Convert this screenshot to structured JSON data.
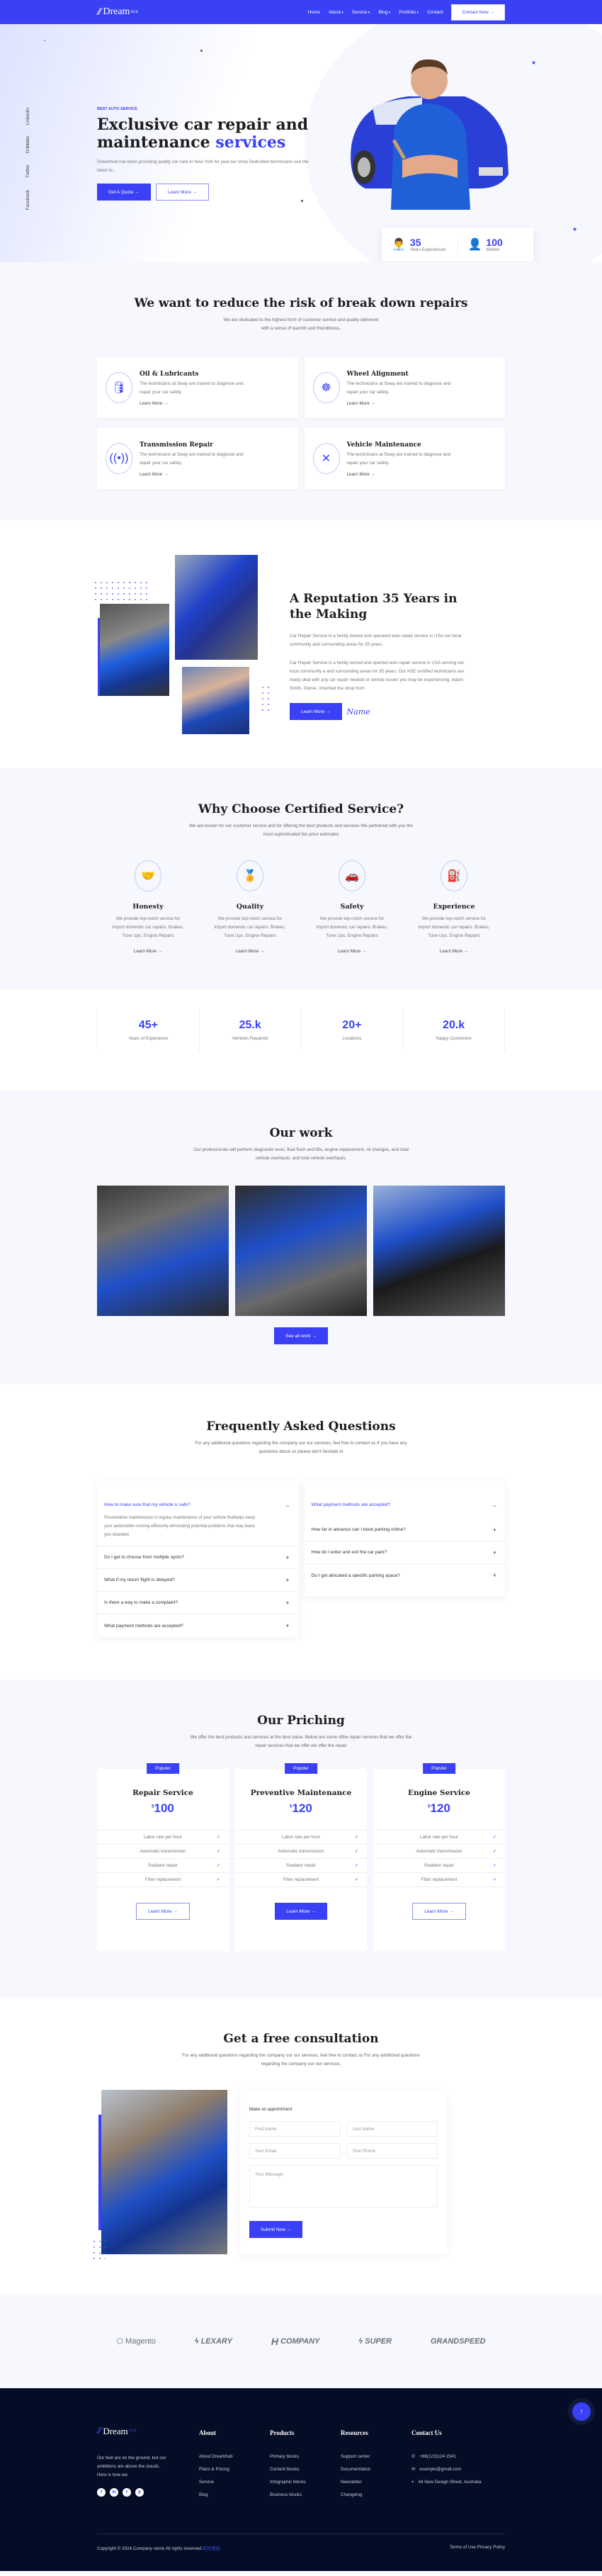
{
  "header": {
    "logo_text": "Dream",
    "logo_sup": "HUB",
    "nav": [
      {
        "label": "Home",
        "dropdown": false
      },
      {
        "label": "About",
        "dropdown": true
      },
      {
        "label": "Service",
        "dropdown": true
      },
      {
        "label": "Blog",
        "dropdown": true
      },
      {
        "label": "Protfolio",
        "dropdown": true
      },
      {
        "label": "Contact",
        "dropdown": false
      }
    ],
    "cta_label": "Contact Now →"
  },
  "hero": {
    "socials": [
      "Linkedin",
      "Dribbble",
      "Twitter",
      "Facebook"
    ],
    "eyebrow": "BEST AUTO SERVICE",
    "title_line1": "Exclusive car repair and",
    "title_line2": "maintenance ",
    "title_accent": "services",
    "description": "Dreamhub has been providing quality car care in New York for year.our shop Dedicated technicians use the latest te...",
    "btn_quote": "Get A Quote  →",
    "btn_learn": "Learn More  →",
    "stat1_num": "35",
    "stat1_label": "Years Experienced",
    "stat2_num": "100",
    "stat2_label": "Worker"
  },
  "services": {
    "title": "We want to reduce the risk of break down repairs",
    "subtitle": "We are dedicated to the highest form of customer service and quality delivered with a sense of warmth and friendliness.",
    "items": [
      {
        "title": "Oil & Lubricants",
        "text": "The technicians at Sway are trained to diagnose and repair your car safely.",
        "link": "Learn More  →",
        "icon": "oil-can-icon"
      },
      {
        "title": "Wheel Alignment",
        "text": "The technicians at Sway are trained to diagnose and repair your car safely.",
        "link": "Learn More  →",
        "icon": "wheel-icon"
      },
      {
        "title": "Transmission Repair",
        "text": "The technicians at Sway are trained to diagnose and repair your car safely.",
        "link": "Learn More  →",
        "icon": "signal-tower-icon"
      },
      {
        "title": "Vehicle Maintenance",
        "text": "The technicians at Sway are trained to diagnose and repair your car safely.",
        "link": "Learn More  →",
        "icon": "wrench-screwdriver-icon"
      }
    ]
  },
  "reputation": {
    "title": "A Reputation 35 Years in the Making",
    "para1": "Car Repair Service is a family owned and operated auto repair service in USA our local community and surrounding areas for 35 years.",
    "para2": "Car Repair Service is a family owned and operted auto repair service in USA serving our local community a and surrounding areas for 35 years. Our ASE certified technicians are ready deal with any car repair needed or vehicle issues you may be experiencing. Adam Smith, Owner, inherited the shop from",
    "btn": "Learn More  →",
    "signature": "Name"
  },
  "why": {
    "title": "Why Choose Certified Service?",
    "subtitle": "We are known for our customer service and for offering the best products and services We partnered with you the most sophisticated fair-price estimates",
    "items": [
      {
        "title": "Honesty",
        "text": "We provide top-notch service for import domestic car repairs. Brakes, Tune Ups, Engine Repairs",
        "link": "Learn More  →"
      },
      {
        "title": "Quality",
        "text": "We provide top-notch service for import domestic car repairs. Brakes, Tune Ups, Engine Repairs",
        "link": "Learn More  →"
      },
      {
        "title": "Safety",
        "text": "We provide top-notch service for import domestic car repairs. Brakes, Tune Ups, Engine Repairs",
        "link": "Learn More  →"
      },
      {
        "title": "Experience",
        "text": "We provide top-notch service for import domestic car repairs. Brakes, Tune Ups, Engine Repairs",
        "link": "Learn More  →"
      }
    ]
  },
  "counters": [
    {
      "num": "45+",
      "label": "Years of Experience"
    },
    {
      "num": "25.k",
      "label": "Vehicles Repaired"
    },
    {
      "num": "20+",
      "label": "Locations"
    },
    {
      "num": "20.k",
      "label": "Happy Customers"
    }
  ],
  "work": {
    "title": "Our work",
    "subtitle": "Our professionals will perform diagnostic tests, fluid flush and fills, engine replacement, oil changes, and total vehicle overhauls. and total vehicle overhauls.",
    "btn": "See all work  →"
  },
  "faq": {
    "title": "Frequently Asked Questions",
    "subtitle": "For any additional questions regarding the company our our services, feel free to contact us If you have any questions about us please don't hesitate to",
    "left": [
      {
        "q": "How to make sure that my vehicle is safe?",
        "a": "Preventative maintenance is regular maintenance of your vehicle thathelps keep your automobile running efficiently eliminating potential problems that may leave you stranded.",
        "open": true
      },
      {
        "q": "Do I get to choose from multiple spots?",
        "open": false
      },
      {
        "q": "What if my return flight is delayed?",
        "open": false
      },
      {
        "q": "Is there a way to make a complaint?",
        "open": false
      },
      {
        "q": "What payment methods are accepted?",
        "open": false
      }
    ],
    "right": [
      {
        "q": "What payment methods are accepted?",
        "open": true
      },
      {
        "q": "How far in advance can I book parking online?",
        "open": false
      },
      {
        "q": "How do I enter and exit the car park?",
        "open": false
      },
      {
        "q": "Do I get allocated a specific parking space?",
        "open": false
      }
    ]
  },
  "pricing": {
    "title": "Our Priching",
    "subtitle": "We offer the best products and services at the best value. Below are some ofthe repair services that we offer the repair services that we offer we offer the repair",
    "plans": [
      {
        "badge": "Populer",
        "name": "Repair Service",
        "currency": "$",
        "price": "100",
        "features": [
          "Labor rate per hour",
          "Automatic transmission",
          "Radiator repair",
          "Filter replacement"
        ],
        "btn": "Learn More  →",
        "highlight": false
      },
      {
        "badge": "Populer",
        "name": "Preventive Maintenance",
        "currency": "$",
        "price": "120",
        "features": [
          "Labor rate per hour",
          "Automatic transmission",
          "Radiator repair",
          "Filter replacement"
        ],
        "btn": "Learn More  →",
        "highlight": true
      },
      {
        "badge": "Populer",
        "name": "Engine Service",
        "currency": "$",
        "price": "120",
        "features": [
          "Labor rate per hour",
          "Automatic transmission",
          "Radiator repair",
          "Filter replacement"
        ],
        "btn": "Learn More  →",
        "highlight": false
      }
    ]
  },
  "consult": {
    "title": "Get a free consultation",
    "subtitle": "For any additional questions regarding the company our our services, feel free to contact us For any additional questions regarding the company our our services,",
    "form_title": "Make an appointment",
    "first_name": "First Name",
    "last_name": "Last Name",
    "email": "Your Email",
    "phone": "Your Phone",
    "message": "Your Massage",
    "submit": "Submit Now  →"
  },
  "brands": [
    "Magento",
    "LEXARY",
    "COMPANY",
    "SUPER",
    "GRANDSPEED"
  ],
  "footer": {
    "tagline": "Our feet are on the ground, but our ambitions are above the clouds. Here is how we",
    "columns": [
      {
        "title": "About",
        "links": [
          "About Dreamhub",
          "Plans & Pricing",
          "Service",
          "Blog"
        ]
      },
      {
        "title": "Products",
        "links": [
          "Primary blocks",
          "Content blocks",
          "Infographic blocks",
          "Business blocks"
        ]
      },
      {
        "title": "Resources",
        "links": [
          "Support center",
          "Documentation",
          "Newsletter",
          "Changelog"
        ]
      }
    ],
    "contact_title": "Contact Us",
    "phone": "+88(123)124 2541",
    "email": "example@gmail.com",
    "address": "44 New Design Street, Australia",
    "copyright": "Copyright © 2024.Company name All rights reserved.",
    "copyright_link": "网页模板",
    "legal": "Terms of Use Privacy Policy"
  },
  "colors": {
    "accent": "#3a40f5",
    "footer_bg": "#050d26",
    "section_bg": "#f7f8fd"
  }
}
